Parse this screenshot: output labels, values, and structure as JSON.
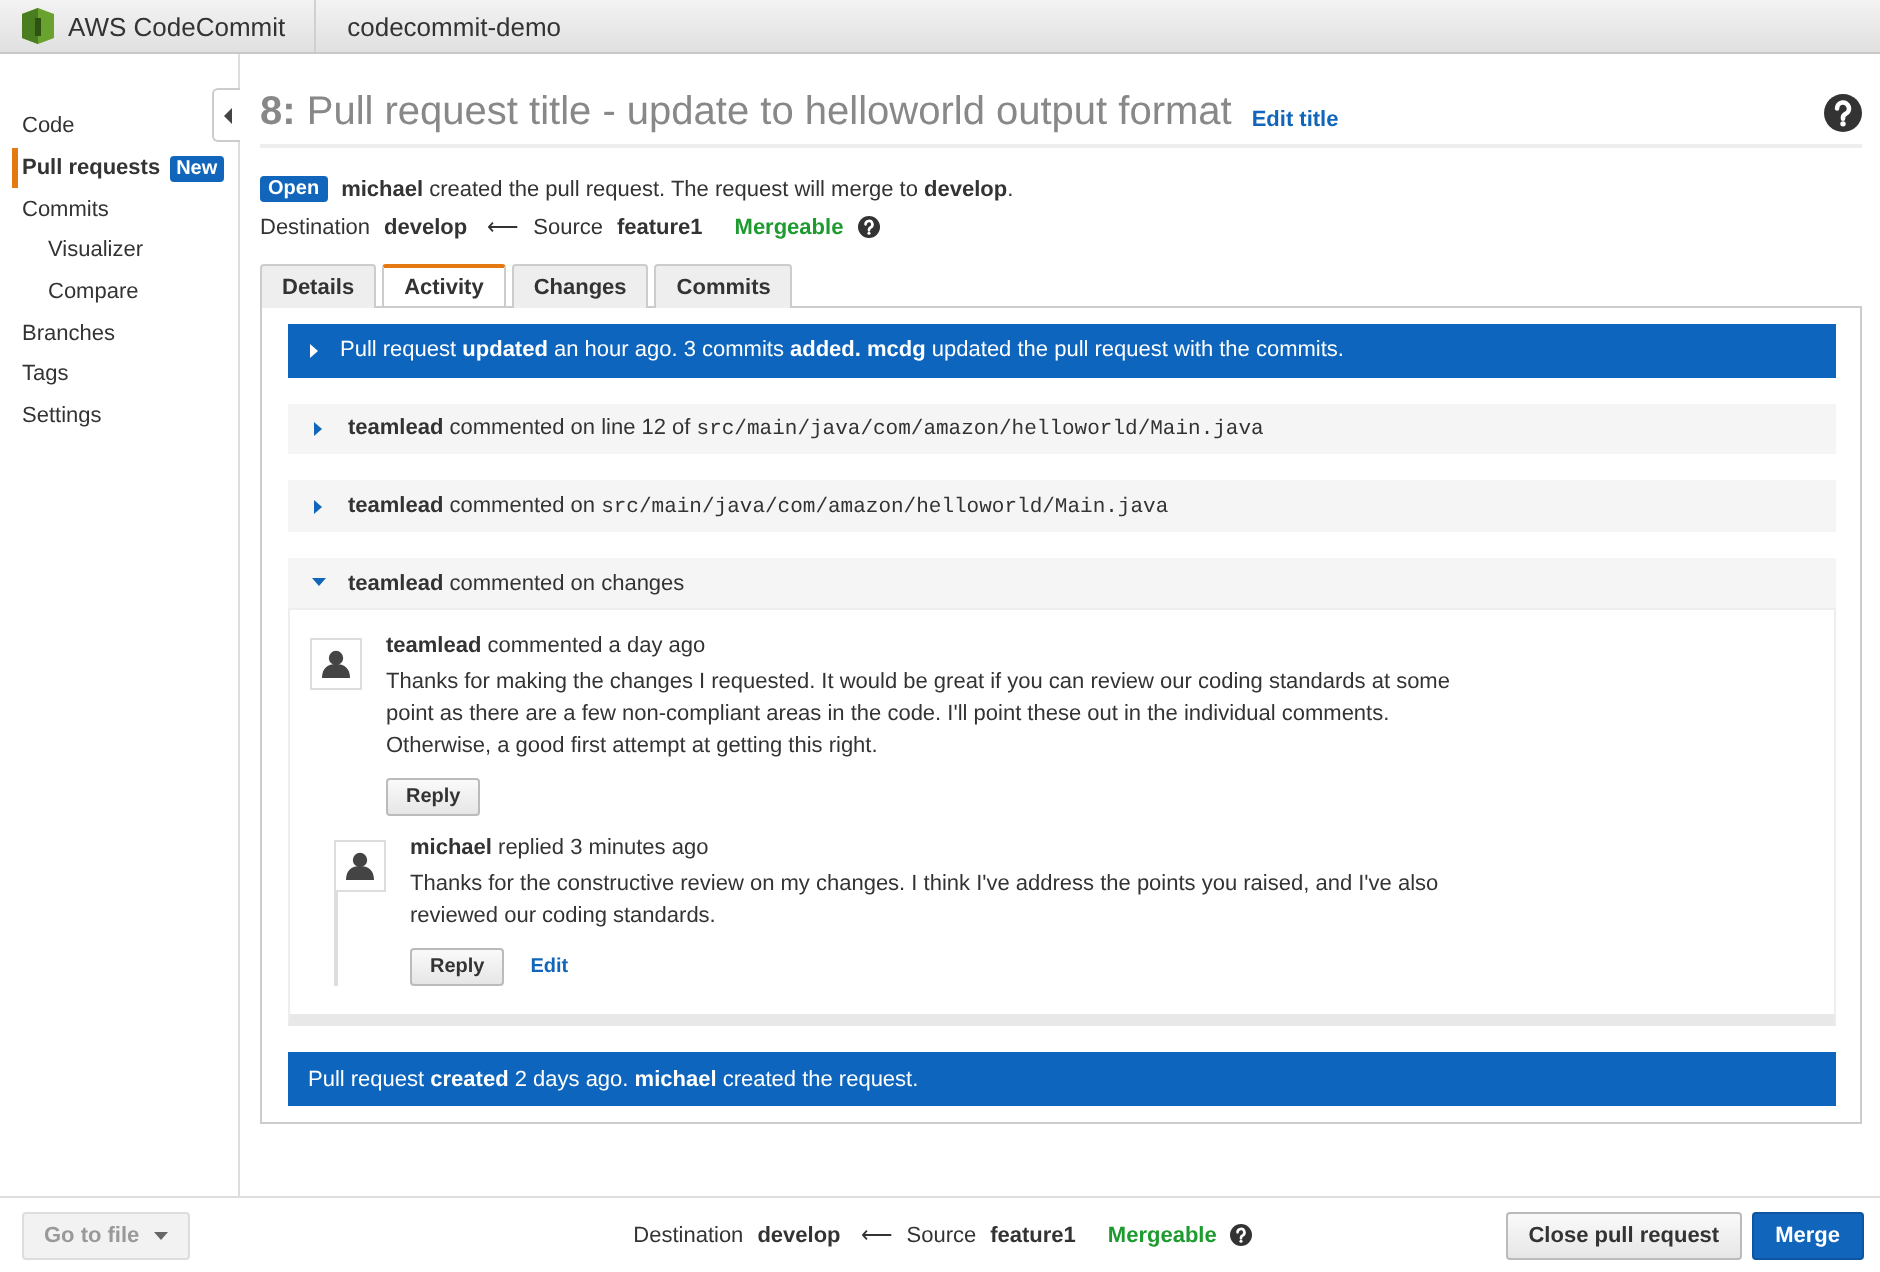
{
  "header": {
    "product": "AWS CodeCommit",
    "repository": "codecommit-demo"
  },
  "sidebar": {
    "items": [
      {
        "label": "Code",
        "selected": false
      },
      {
        "label": "Pull requests",
        "selected": true,
        "badge": "New"
      },
      {
        "label": "Commits",
        "selected": false,
        "children": [
          {
            "label": "Visualizer",
            "selected": false
          },
          {
            "label": "Compare",
            "selected": false
          }
        ]
      },
      {
        "label": "Branches",
        "selected": false
      },
      {
        "label": "Tags",
        "selected": false
      },
      {
        "label": "Settings",
        "selected": false
      }
    ]
  },
  "pull_request": {
    "number": "8:",
    "title": "Pull request title - update to helloworld output format",
    "edit_link": "Edit title",
    "status": "Open",
    "summary": "**michael** created the pull request. The request will merge to **develop**.",
    "destination_label": "Destination",
    "destination": "develop",
    "arrow": "⟵",
    "source_label": "Source",
    "source": "feature1",
    "merge_status": "Mergeable"
  },
  "tabs": [
    {
      "label": "Details",
      "selected": false
    },
    {
      "label": "Activity",
      "selected": true
    },
    {
      "label": "Changes",
      "selected": false
    },
    {
      "label": "Commits",
      "selected": false
    }
  ],
  "activity": [
    {
      "kind": "event",
      "expanded": false,
      "text": "Pull request **updated** an hour ago. 3 commits **added.** **mcdg** updated the pull request with the commits."
    },
    {
      "kind": "comment",
      "expanded": false,
      "text": "**teamlead** commented on line 12 of ",
      "path": "src/main/java/com/amazon/helloworld/Main.java"
    },
    {
      "kind": "comment",
      "expanded": false,
      "text": "**teamlead** commented on ",
      "path": "src/main/java/com/amazon/helloworld/Main.java"
    },
    {
      "kind": "comment",
      "expanded": true,
      "text": "**teamlead** commented on changes",
      "thread": {
        "heading": "**teamlead** commented a day ago",
        "body": "Thanks for making the changes I requested. It would be great if you can review our coding standards at some point as there are a few non-compliant areas in the code. I'll point these out in the individual comments. Otherwise, a good first attempt at getting this right.",
        "actions": [
          {
            "label": "Reply",
            "kind": "button"
          }
        ],
        "replies": [
          {
            "heading": "**michael** replied 3 minutes ago",
            "body": "Thanks for the constructive review on my changes. I think I've address the points you raised, and I've also reviewed our coding standards.",
            "actions": [
              {
                "label": "Reply",
                "kind": "button"
              },
              {
                "label": "Edit",
                "kind": "link"
              }
            ]
          }
        ]
      }
    },
    {
      "kind": "event",
      "text": "Pull request **created** 2 days ago. **michael** created the request."
    }
  ],
  "footer": {
    "go_to_file": "Go to file",
    "destination_label": "Destination",
    "destination": "develop",
    "arrow": "⟵",
    "source_label": "Source",
    "source": "feature1",
    "merge_status": "Mergeable",
    "buttons": [
      {
        "label": "Close pull request",
        "kind": "secondary"
      },
      {
        "label": "Merge",
        "kind": "primary"
      }
    ]
  }
}
